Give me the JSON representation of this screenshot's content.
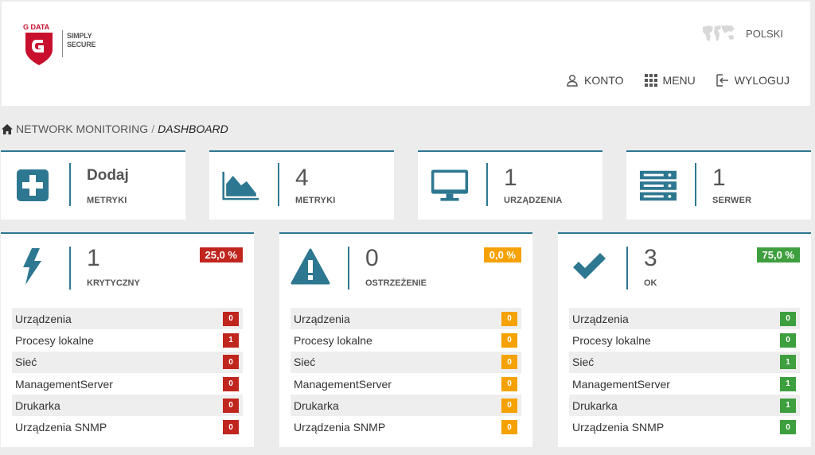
{
  "colors": {
    "accent": "#2e7791",
    "critical": "#c0251e",
    "warning": "#f5a200",
    "ok": "#3e9f3e"
  },
  "logo": {
    "brand": "G DATA",
    "slogan_line1": "SIMPLY",
    "slogan_line2": "SECURE"
  },
  "header": {
    "language": "POLSKI",
    "nav": {
      "account": "KONTO",
      "menu": "MENU",
      "logout": "WYLOGUJ"
    }
  },
  "breadcrumb": {
    "root": "NETWORK MONITORING",
    "separator": "/",
    "current": "DASHBOARD"
  },
  "stats": [
    {
      "icon": "plus-square-icon",
      "value": "Dodaj",
      "label": "METRYKI"
    },
    {
      "icon": "area-chart-icon",
      "value": "4",
      "label": "METRYKI"
    },
    {
      "icon": "monitor-icon",
      "value": "1",
      "label": "URZĄDZENIA"
    },
    {
      "icon": "server-icon",
      "value": "1",
      "label": "SERWER"
    }
  ],
  "status": [
    {
      "icon": "lightning-icon",
      "value": "1",
      "label": "KRYTYCZNY",
      "percent": "25,0 %",
      "rows": [
        {
          "name": "Urządzenia",
          "count": "0"
        },
        {
          "name": "Procesy lokalne",
          "count": "1"
        },
        {
          "name": "Sieć",
          "count": "0"
        },
        {
          "name": "ManagementServer",
          "count": "0"
        },
        {
          "name": "Drukarka",
          "count": "0"
        },
        {
          "name": "Urządzenia SNMP",
          "count": "0"
        }
      ]
    },
    {
      "icon": "warning-icon",
      "value": "0",
      "label": "OSTRZEŻENIE",
      "percent": "0,0 %",
      "rows": [
        {
          "name": "Urządzenia",
          "count": "0"
        },
        {
          "name": "Procesy lokalne",
          "count": "0"
        },
        {
          "name": "Sieć",
          "count": "0"
        },
        {
          "name": "ManagementServer",
          "count": "0"
        },
        {
          "name": "Drukarka",
          "count": "0"
        },
        {
          "name": "Urządzenia SNMP",
          "count": "0"
        }
      ]
    },
    {
      "icon": "checkmark-icon",
      "value": "3",
      "label": "OK",
      "percent": "75,0 %",
      "rows": [
        {
          "name": "Urządzenia",
          "count": "0"
        },
        {
          "name": "Procesy lokalne",
          "count": "0"
        },
        {
          "name": "Sieć",
          "count": "1"
        },
        {
          "name": "ManagementServer",
          "count": "1"
        },
        {
          "name": "Drukarka",
          "count": "1"
        },
        {
          "name": "Urządzenia SNMP",
          "count": "0"
        }
      ]
    }
  ]
}
